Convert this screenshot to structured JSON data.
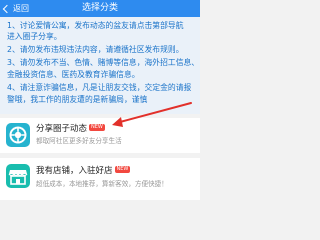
{
  "header": {
    "back_label": "返回",
    "title": "选择分类"
  },
  "notice_lines": [
    "1、讨论爱情公寓，发布动态的盆友请点击第部导航",
    "进入圈子分享。",
    "2、请勿发布违规违法内容，请遵循社区发布规则。",
    "3、请勿发布不当、色情、赌博等信息，海外招工信息、",
    "金融投资信息、医药及教育诈骗信息。",
    "4、请注意诈骗信息，凡是让朋友交钱，交定金的请报",
    "警哦，我工作的朋友遭的是新骗局，谨慎"
  ],
  "categories": [
    {
      "title": "分享圈子动态",
      "badge": "NEW",
      "desc": "都取阿社区更多好友分享生活"
    },
    {
      "title": "我有店铺，入驻好店",
      "badge": "NEW",
      "desc": "超低成本，本地推荐，算新客效，方便快捷！"
    }
  ],
  "colors": {
    "header_bg": "#2e8bef",
    "notice_text": "#1a73c9",
    "badge_bg": "#f2483f",
    "arrow": "#e2302a"
  }
}
